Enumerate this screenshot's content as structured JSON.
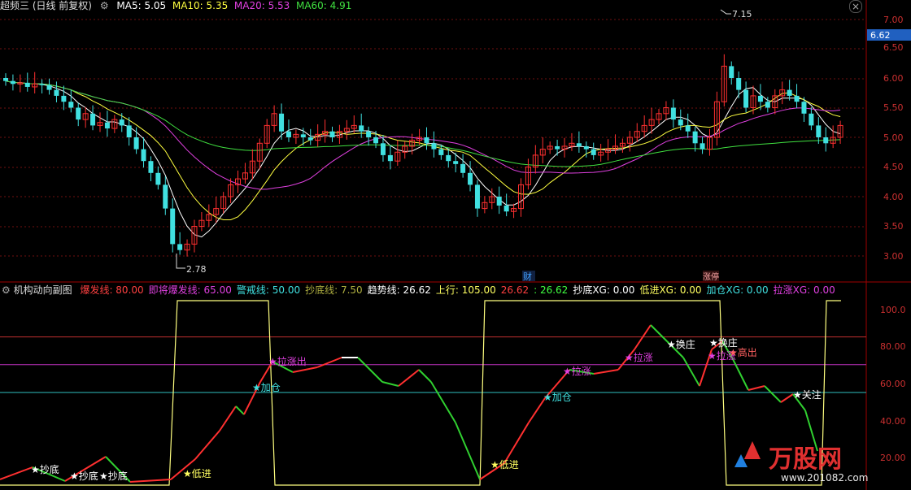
{
  "header_top": {
    "title": "超频三 (日线 前复权)",
    "ma5": "MA5: 5.05",
    "ma10": "MA10: 5.35",
    "ma20": "MA20: 5.53",
    "ma60": "MA60: 4.91"
  },
  "header_sub": {
    "title": "机构动向副图",
    "items": [
      {
        "text": "爆发线: 80.00",
        "color": "#ff4040"
      },
      {
        "text": "即将爆发线: 65.00",
        "color": "#e040e0"
      },
      {
        "text": "警戒线: 50.00",
        "color": "#40e0e0"
      },
      {
        "text": "抄底线: 7.50",
        "color": "#b0b040"
      },
      {
        "text": "趋势线: 26.62",
        "color": "#ffffff"
      },
      {
        "text": "上行: 105.00",
        "color": "#ffff60"
      },
      {
        "text": "26.62",
        "color": "#ff4040"
      },
      {
        "text": ": 26.62",
        "color": "#40ff40"
      },
      {
        "text": "抄底XG: 0.00",
        "color": "#ffffff"
      },
      {
        "text": "低进XG: 0.00",
        "color": "#ffff60"
      },
      {
        "text": "加仓XG: 0.00",
        "color": "#40e0e0"
      },
      {
        "text": "拉涨XG: 0.00",
        "color": "#e040e0"
      }
    ]
  },
  "price_axis": [
    "7.00",
    "6.50",
    "6.00",
    "5.50",
    "5.00",
    "4.50",
    "4.00",
    "3.50",
    "3.00"
  ],
  "price_label": "6.62",
  "sub_axis": [
    "100.0",
    "80.00",
    "60.00",
    "40.00",
    "20.00"
  ],
  "annotations": {
    "high": "7.15",
    "low": "2.78",
    "cai": "财",
    "tag": "涨停"
  },
  "signals": [
    {
      "text": "抄底",
      "color": "#ffffff"
    },
    {
      "text": "抄底",
      "color": "#ffffff"
    },
    {
      "text": "抄底",
      "color": "#ffffff"
    },
    {
      "text": "低进",
      "color": "#ffff60"
    },
    {
      "text": "加仓",
      "color": "#40e0e0"
    },
    {
      "text": "拉涨出",
      "color": "#e040e0"
    },
    {
      "text": "低进",
      "color": "#ffff60"
    },
    {
      "text": "加仓",
      "color": "#40e0e0"
    },
    {
      "text": "拉涨",
      "color": "#e040e0"
    },
    {
      "text": "拉涨",
      "color": "#e040e0"
    },
    {
      "text": "换庄",
      "color": "#ffffff"
    },
    {
      "text": "拉涨",
      "color": "#e040e0"
    },
    {
      "text": "高出",
      "color": "#ff6060"
    },
    {
      "text": "换庄",
      "color": "#ffffff"
    },
    {
      "text": "关注",
      "color": "#ffffff"
    }
  ],
  "watermark": {
    "brand": "万股网",
    "url": "www.201082.com"
  },
  "colors": {
    "up": "#ff3030",
    "down": "#40e0e0",
    "ma5": "#ffffff",
    "ma10": "#ffff40",
    "ma20": "#e040e0",
    "ma60": "#40e040",
    "grid": "#800000"
  }
}
